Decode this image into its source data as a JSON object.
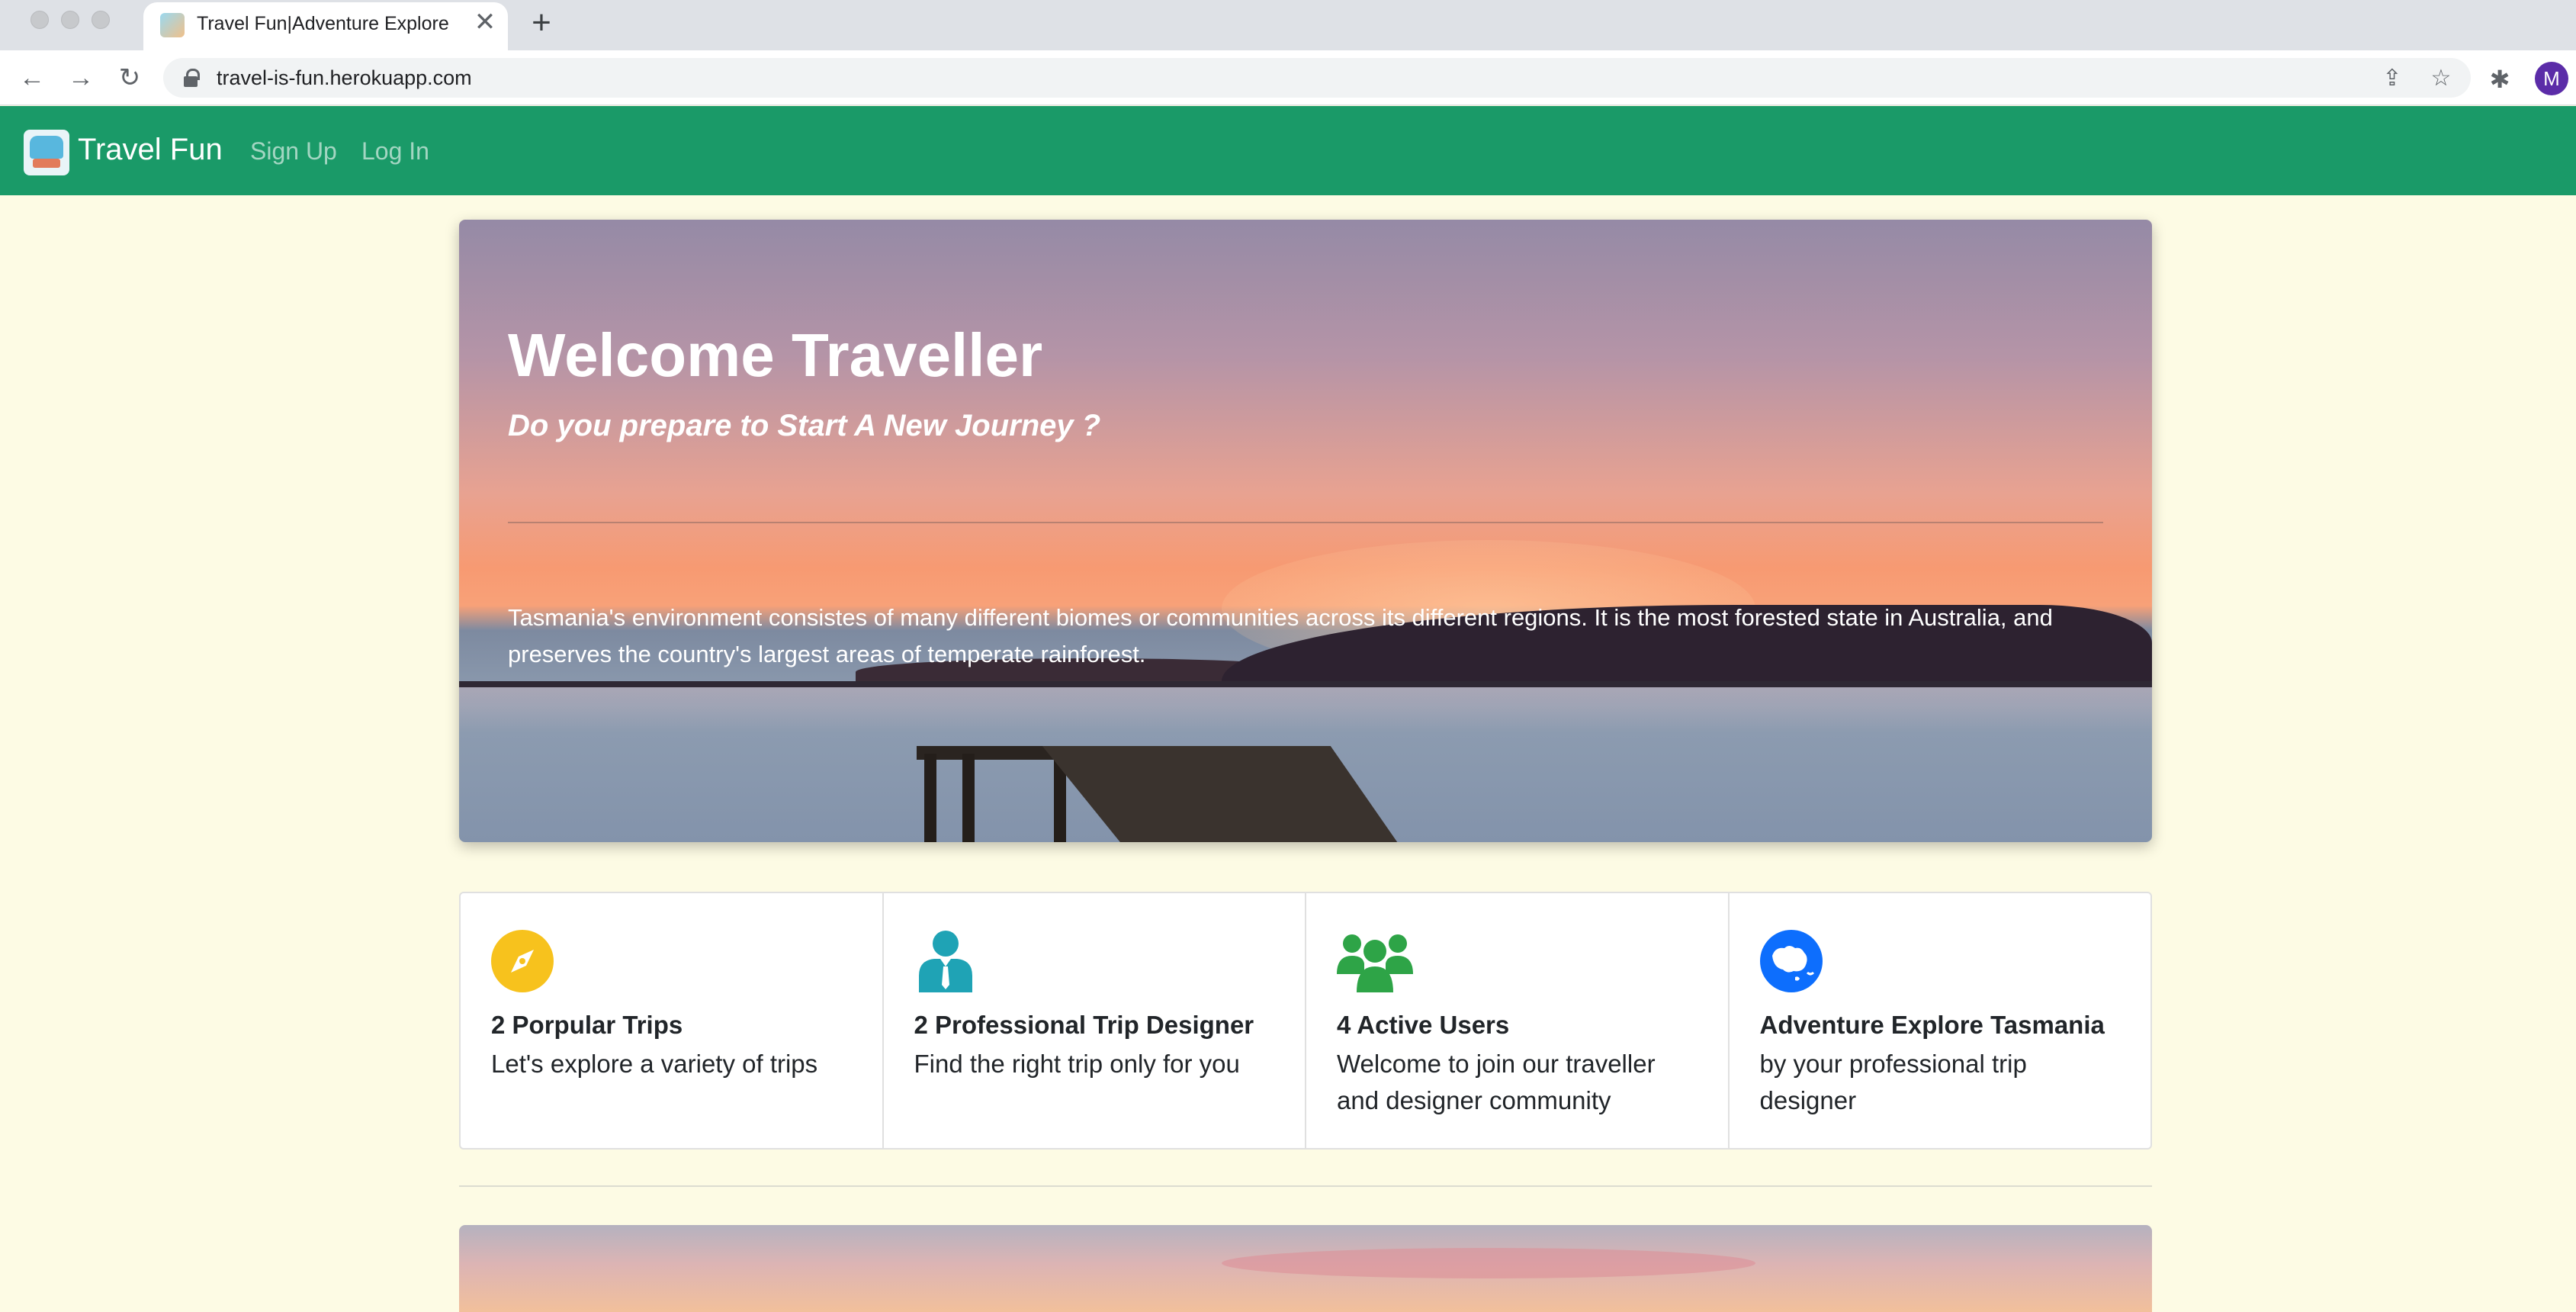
{
  "browser": {
    "tab_title": "Travel Fun|Adventure Explore",
    "tab_close": "✕",
    "new_tab": "+",
    "back": "←",
    "forward": "→",
    "reload": "↻",
    "url": "travel-is-fun.herokuapp.com",
    "share_icon": "⇪",
    "bookmark_icon": "☆",
    "extensions_icon": "✱",
    "profile_initial": "M"
  },
  "navbar": {
    "brand": "Travel Fun",
    "links": [
      "Sign Up",
      "Log In"
    ],
    "color": "#1a9a68"
  },
  "hero": {
    "title": "Welcome Traveller",
    "subtitle": "Do you prepare to Start A New Journey ?",
    "text": "Tasmania's environment consistes of many different biomes or communities across its different regions. It is the most forested state in Australia, and preserves the country's largest areas of temperate rainforest."
  },
  "features": [
    {
      "icon": "compass-icon",
      "color": "#f7c21d",
      "title": "2 Porpular Trips",
      "text": "Let's explore a variety of trips"
    },
    {
      "icon": "designer-icon",
      "color": "#1fa3b5",
      "title": "2 Professional Trip Designer",
      "text": "Find the right trip only for you"
    },
    {
      "icon": "users-icon",
      "color": "#2ea447",
      "title": "4 Active Users",
      "text": "Welcome to join our traveller and designer community"
    },
    {
      "icon": "australia-globe-icon",
      "color": "#0d6efd",
      "title": "Adventure Explore Tasmania",
      "text": "by your professional trip designer"
    }
  ]
}
